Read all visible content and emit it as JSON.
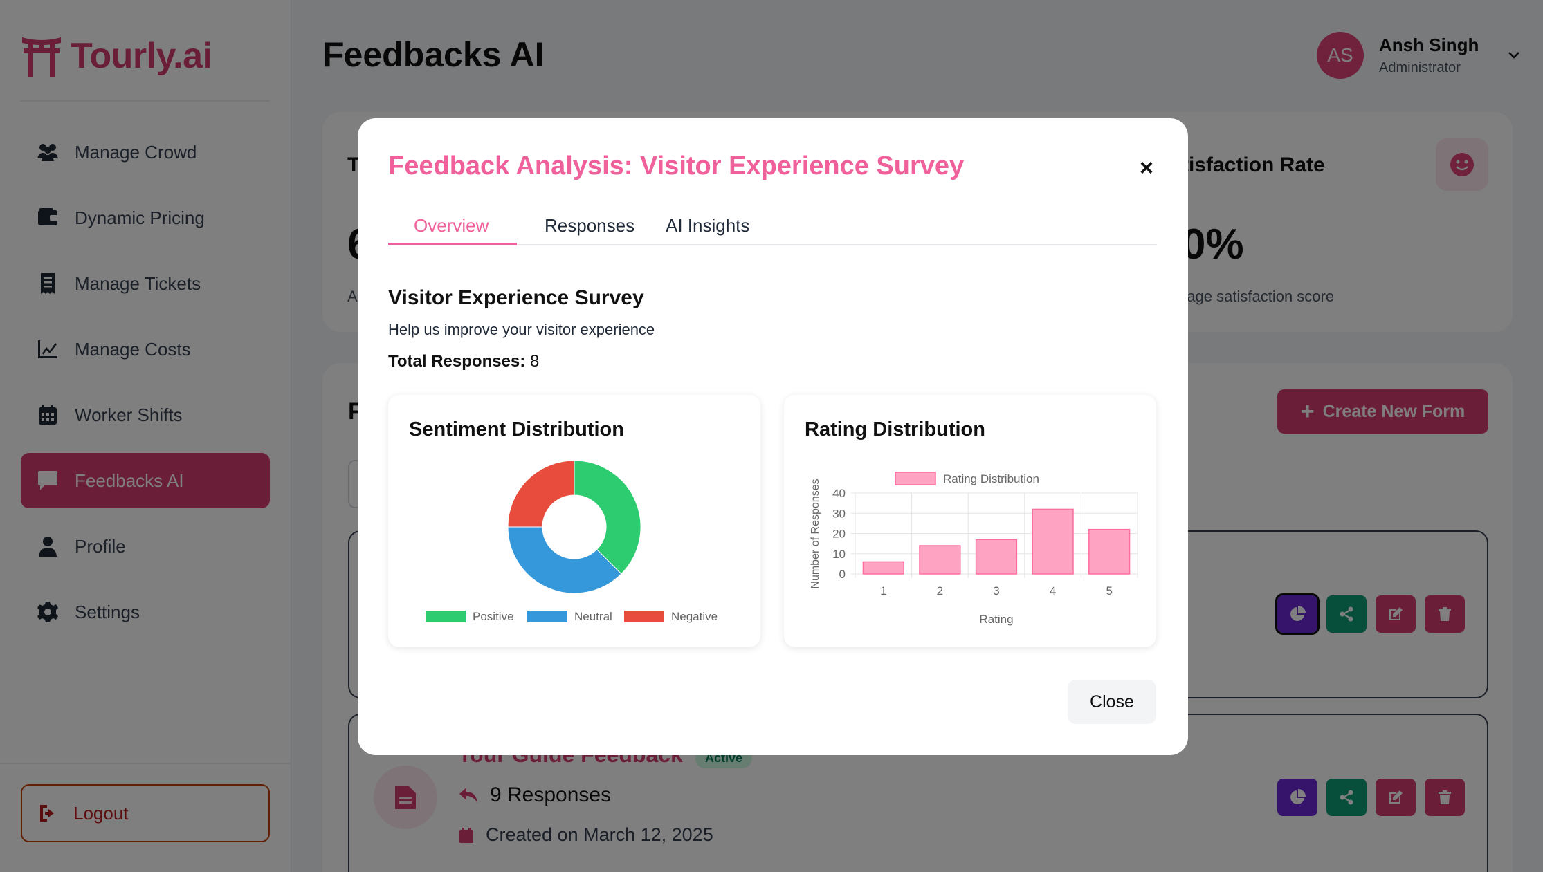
{
  "app": {
    "brand": "Tourly.ai",
    "page_title": "Feedbacks AI"
  },
  "sidebar": {
    "items": [
      {
        "label": "Manage Crowd",
        "icon": "users-icon"
      },
      {
        "label": "Dynamic Pricing",
        "icon": "wallet-icon"
      },
      {
        "label": "Manage Tickets",
        "icon": "receipt-icon"
      },
      {
        "label": "Manage Costs",
        "icon": "chart-line-icon"
      },
      {
        "label": "Worker Shifts",
        "icon": "calendar-icon"
      },
      {
        "label": "Feedbacks AI",
        "icon": "comment-icon",
        "active": true
      },
      {
        "label": "Profile",
        "icon": "user-icon"
      },
      {
        "label": "Settings",
        "icon": "gear-icon"
      }
    ],
    "logout_label": "Logout"
  },
  "user": {
    "initials": "AS",
    "name": "Ansh Singh",
    "role": "Administrator"
  },
  "background": {
    "stat_left_label_fragment": "T",
    "stat_left_value_fragment": "6",
    "stat_left_sub_fragment": "A",
    "stat_right_label_fragment": "tisfaction Rate",
    "stat_right_value_fragment": "0%",
    "stat_right_sub_fragment": "rage satisfaction score",
    "forms_heading_fragment": "F",
    "create_button_label": "Create New Form",
    "row2": {
      "title_fragment": "Tour Guide Feedback",
      "status": "Active",
      "responses": "9 Responses",
      "created": "Created on March 12, 2025"
    }
  },
  "modal": {
    "title": "Feedback Analysis: Visitor Experience Survey",
    "close_x": "×",
    "tabs": [
      "Overview",
      "Responses",
      "AI Insights"
    ],
    "active_tab": "Overview",
    "survey_title": "Visitor Experience Survey",
    "survey_description": "Help us improve your visitor experience",
    "total_label": "Total Responses:",
    "total_value": "8",
    "close_button": "Close"
  },
  "chart_data": [
    {
      "type": "pie",
      "variant": "doughnut",
      "title": "Sentiment Distribution",
      "categories": [
        "Positive",
        "Neutral",
        "Negative"
      ],
      "values": [
        37.5,
        37.5,
        25
      ],
      "colors": [
        "#2ecc71",
        "#3498db",
        "#e74c3c"
      ],
      "legend": "bottom"
    },
    {
      "type": "bar",
      "title": "Rating Distribution",
      "series": [
        {
          "name": "Rating Distribution",
          "values": [
            6,
            14,
            17,
            32,
            22
          ]
        }
      ],
      "categories": [
        "1",
        "2",
        "3",
        "4",
        "5"
      ],
      "xlabel": "Rating",
      "ylabel": "Number of Responses",
      "ylim": [
        0,
        40
      ],
      "yticks": [
        0,
        10,
        20,
        30,
        40
      ],
      "bar_color": "#ffa3c2",
      "bar_border": "#ff6f9e",
      "legend": "top",
      "grid": true
    }
  ]
}
